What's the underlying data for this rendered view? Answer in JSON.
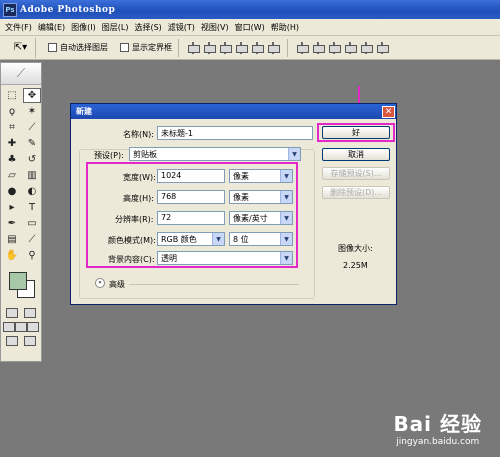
{
  "app": {
    "icon_text": "Ps",
    "title": "Adobe Photoshop"
  },
  "menu": [
    "文件(F)",
    "编辑(E)",
    "图像(I)",
    "图层(L)",
    "选择(S)",
    "滤镜(T)",
    "视图(V)",
    "窗口(W)",
    "帮助(H)"
  ],
  "options": {
    "auto_select": "自动选择图层",
    "show_bounds": "显示定界框"
  },
  "dialog": {
    "title": "新建",
    "name_label": "名称(N):",
    "name_value": "未标题-1",
    "preset_label": "预设(P):",
    "preset_value": "剪贴板",
    "width_label": "宽度(W):",
    "width_value": "1024",
    "width_unit": "像素",
    "height_label": "高度(H):",
    "height_value": "768",
    "height_unit": "像素",
    "resolution_label": "分辨率(R):",
    "resolution_value": "72",
    "resolution_unit": "像素/英寸",
    "color_mode_label": "颜色模式(M):",
    "color_mode_value": "RGB 颜色",
    "bit_depth": "8 位",
    "background_label": "背景内容(C):",
    "background_value": "透明",
    "advanced": "高级",
    "ok": "好",
    "cancel": "取消",
    "save_preset": "存储预设(S)...",
    "delete_preset": "删除预设(D)...",
    "image_size_label": "图像大小:",
    "image_size_value": "2.25M"
  },
  "watermark": {
    "main": "Bai 经验",
    "url": "jingyan.baidu.com"
  },
  "colors": {
    "highlight": "#e327c9",
    "foreground": "#a7c8a6"
  }
}
